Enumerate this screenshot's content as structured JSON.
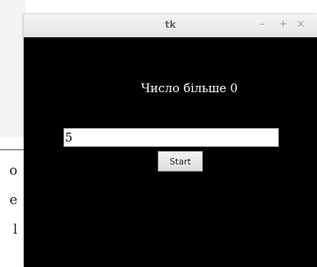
{
  "background": {
    "lines": [
      "о",
      "е",
      "l"
    ]
  },
  "window": {
    "title": "tk",
    "controls": {
      "minimize": "–",
      "maximize": "+",
      "close": "×"
    }
  },
  "app": {
    "label": "Число більше 0",
    "entry_value": "5",
    "button_label": "Start"
  }
}
